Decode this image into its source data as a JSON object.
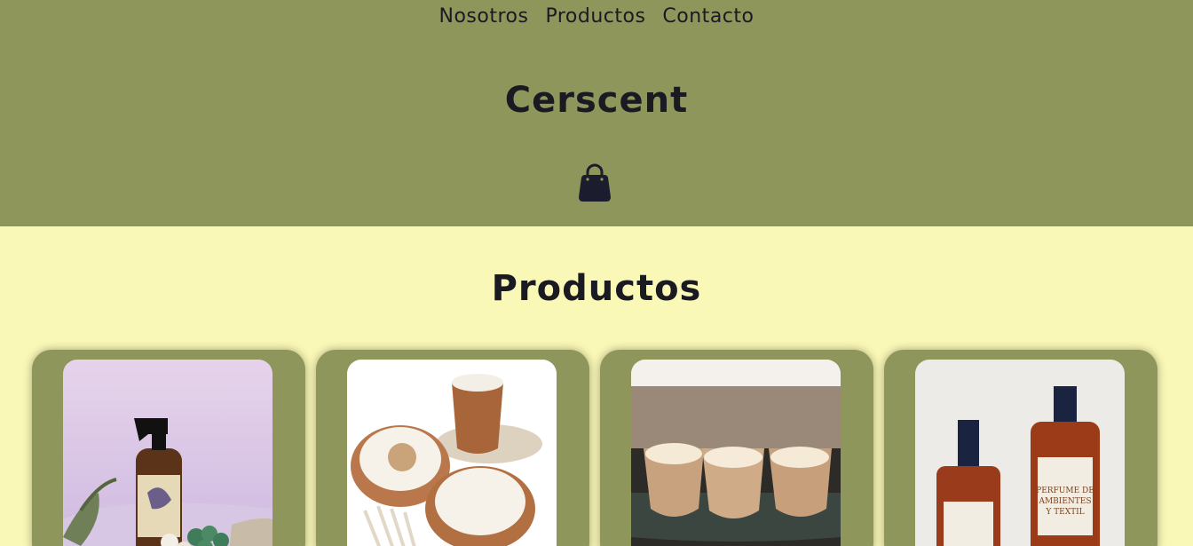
{
  "nav": {
    "items": [
      "Nosotros",
      "Productos",
      "Contacto"
    ]
  },
  "header": {
    "brand": "Cerscent"
  },
  "cart": {
    "icon": "shopping-bag-icon"
  },
  "products_section": {
    "title": "Productos"
  },
  "products": [
    {
      "image": "room-spray-bottle-image"
    },
    {
      "image": "wooden-candle-bowls-image"
    },
    {
      "image": "three-wooden-candles-image"
    },
    {
      "image": "perfume-textile-sprays-image",
      "label_text": "PERFUME DE AMBIENTES Y TEXTIL"
    }
  ],
  "colors": {
    "header_bg": "#8e965c",
    "page_bg": "#faf8b6",
    "text": "#1a1a22",
    "card_bg": "#8e965c"
  }
}
